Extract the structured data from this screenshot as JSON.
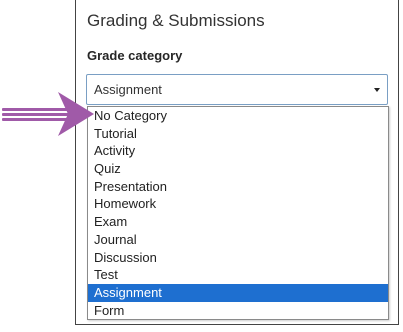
{
  "section": {
    "title": "Grading & Submissions"
  },
  "grade_category": {
    "label": "Grade category",
    "selected_value": "Assignment",
    "options": [
      "No Category",
      "Tutorial",
      "Activity",
      "Quiz",
      "Presentation",
      "Homework",
      "Exam",
      "Journal",
      "Discussion",
      "Test",
      "Assignment",
      "Form"
    ],
    "highlighted_index": 10
  },
  "colors": {
    "highlight": "#1e6fd0",
    "arrow": "#a05aa8",
    "focus_border": "#7a9fc4"
  },
  "icons": {
    "dropdown": "caret-down-icon",
    "annotation": "pointer-arrow-icon"
  }
}
